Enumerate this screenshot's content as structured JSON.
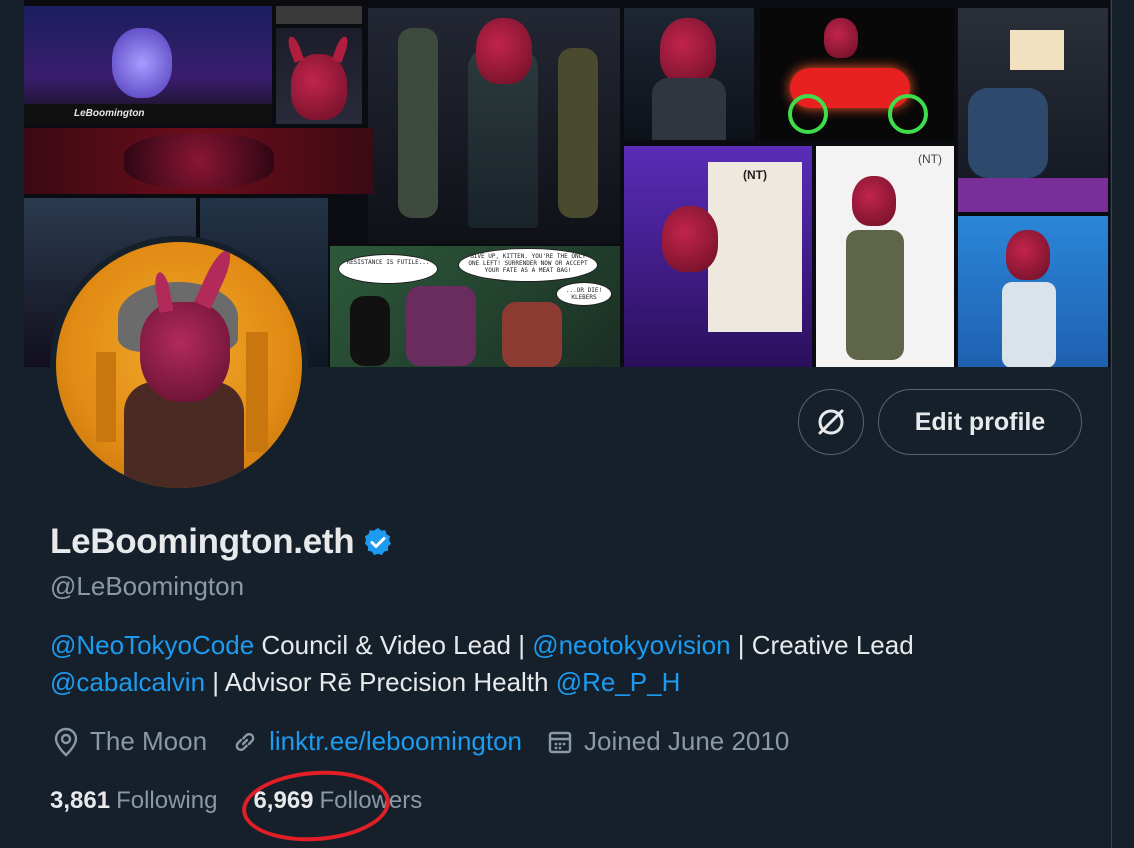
{
  "banner": {
    "tile_label": "LeBoomington",
    "comic_bubbles": [
      "RESISTANCE IS FUTILE...",
      "GIVE UP, KITTEN. YOU'RE THE ONLY ONE LEFT! SURRENDER NOW OR ACCEPT YOUR FATE AS A MEAT BAG!",
      "...OR DIE! KLEBERS"
    ],
    "brand_mark": "(NT)"
  },
  "actions": {
    "edit_profile_label": "Edit profile"
  },
  "profile": {
    "display_name": "LeBoomington.eth",
    "handle": "@LeBoomington",
    "bio": {
      "line1": {
        "mention1": "@NeoTokyoCode",
        "text1": " Council & Video Lead | ",
        "mention2": "@neotokyovision",
        "text2": " | Creative Lead"
      },
      "line2": {
        "mention1": "@cabalcalvin",
        "text1": " | Advisor Rē Precision Health ",
        "mention2": "@Re_P_H"
      }
    },
    "location": "The Moon",
    "website": "linktr.ee/leboomington",
    "joined": "Joined June 2010"
  },
  "stats": {
    "following_count": "3,861",
    "following_label": "Following",
    "followers_count": "6,969",
    "followers_label": "Followers"
  },
  "colors": {
    "background": "#15202b",
    "accent": "#1d9bf0",
    "annotation": "#e21f26"
  }
}
